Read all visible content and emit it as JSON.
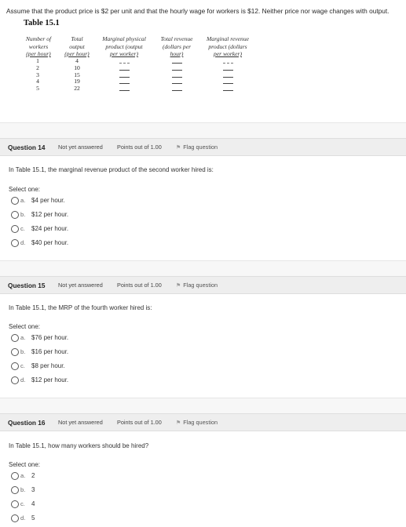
{
  "intro": "Assume that the product price is $2 per unit and that the hourly wage for workers is $12.  Neither price nor wage changes with output.",
  "table": {
    "title": "Table 15.1",
    "headers": [
      {
        "lines": [
          "Number of",
          "workers",
          "(per hour)"
        ]
      },
      {
        "lines": [
          "Total",
          "output",
          "(per hour)"
        ]
      },
      {
        "lines": [
          "Marginal physical",
          "product (output",
          "per worker)"
        ]
      },
      {
        "lines": [
          "Total revenue",
          "(dollars per",
          "hour)"
        ]
      },
      {
        "lines": [
          "Marginal revenue",
          "product (dollars",
          "per worker)"
        ]
      }
    ],
    "workers": [
      "1",
      "2",
      "3",
      "4",
      "5"
    ],
    "output": [
      "4",
      "10",
      "15",
      "19",
      "22"
    ]
  },
  "questions": [
    {
      "number": "Question 14",
      "status": "Not yet answered",
      "points": "Points out of 1.00",
      "flag": "Flag question",
      "text": "In Table 15.1, the marginal revenue product of the second worker hired is:",
      "select": "Select one:",
      "options": [
        {
          "letter": "a.",
          "text": "$4 per hour."
        },
        {
          "letter": "b.",
          "text": "$12 per hour."
        },
        {
          "letter": "c.",
          "text": "$24 per hour."
        },
        {
          "letter": "d.",
          "text": "$40 per hour."
        }
      ]
    },
    {
      "number": "Question 15",
      "status": "Not yet answered",
      "points": "Points out of 1.00",
      "flag": "Flag question",
      "text": "In Table 15.1, the MRP of the fourth worker hired is:",
      "select": "Select one:",
      "options": [
        {
          "letter": "a.",
          "text": "$76 per hour."
        },
        {
          "letter": "b.",
          "text": "$16 per hour."
        },
        {
          "letter": "c.",
          "text": "$8 per hour."
        },
        {
          "letter": "d.",
          "text": "$12 per hour."
        }
      ]
    },
    {
      "number": "Question 16",
      "status": "Not yet answered",
      "points": "Points out of 1.00",
      "flag": "Flag question",
      "text": "In Table 15.1, how many workers should be hired?",
      "select": "Select one:",
      "options": [
        {
          "letter": "a.",
          "text": "2"
        },
        {
          "letter": "b.",
          "text": "3"
        },
        {
          "letter": "c.",
          "text": "4"
        },
        {
          "letter": "d.",
          "text": "5"
        }
      ]
    }
  ]
}
